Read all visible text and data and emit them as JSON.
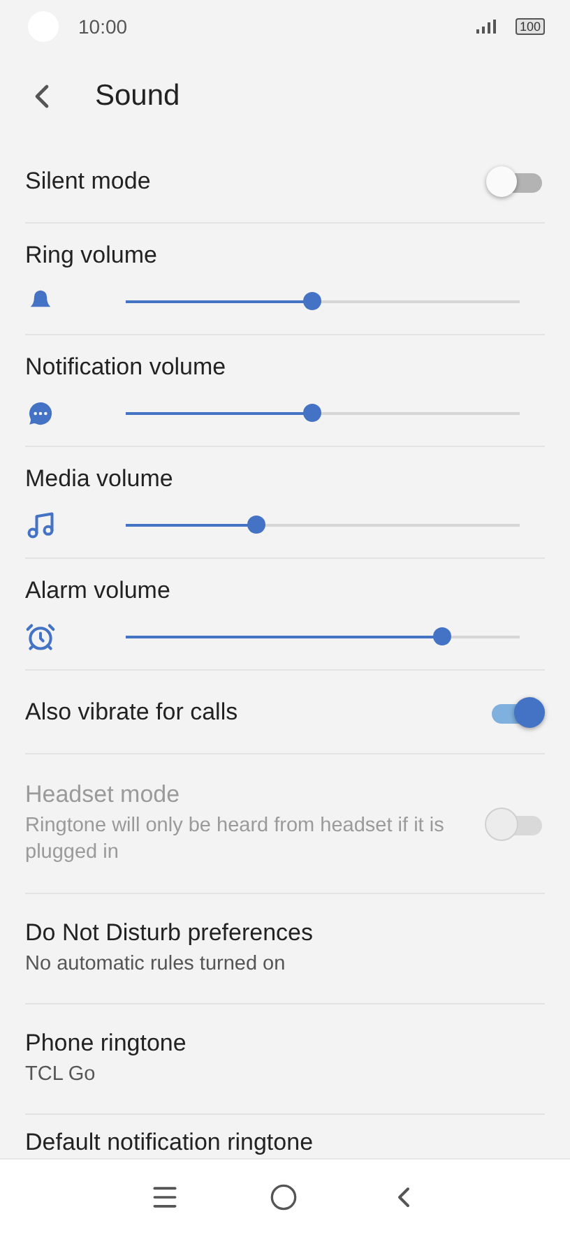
{
  "status_bar": {
    "time": "10:00",
    "battery": "100"
  },
  "header": {
    "title": "Sound"
  },
  "settings": [
    {
      "kind": "switch",
      "label": "Silent mode",
      "on": false,
      "disabled": false
    },
    {
      "kind": "slider",
      "label": "Ring volume",
      "level": 0.47
    },
    {
      "kind": "slider",
      "label": "Notification volume",
      "level": 0.47
    },
    {
      "kind": "slider",
      "label": "Media volume",
      "level": 0.33
    },
    {
      "kind": "slider",
      "label": "Alarm volume",
      "level": 0.8
    },
    {
      "kind": "switch",
      "label": "Also vibrate for calls",
      "on": true,
      "disabled": false
    },
    {
      "kind": "switch",
      "label": "Headset mode",
      "summary": "Ringtone will only be heard from headset if it is plugged in",
      "on": false,
      "disabled": true
    },
    {
      "kind": "link",
      "label": "Do Not Disturb preferences",
      "summary": "No automatic rules turned on"
    },
    {
      "kind": "link",
      "label": "Phone ringtone",
      "summary": "TCL Go"
    },
    {
      "kind": "link",
      "label": "Default notification ringtone"
    }
  ]
}
